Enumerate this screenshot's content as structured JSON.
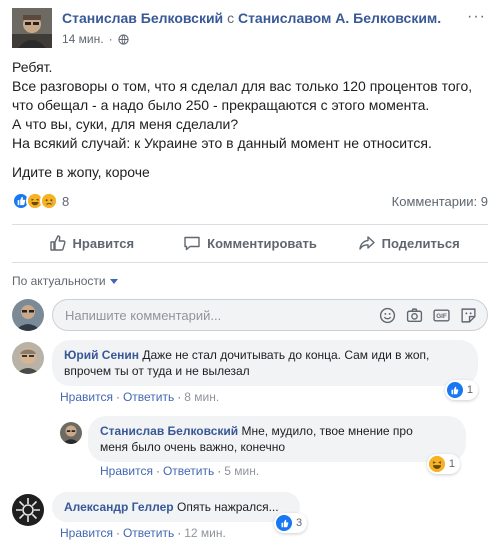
{
  "post": {
    "author": "Станислав Белковский",
    "with_prefix": "с",
    "tagged": "Станиславом А. Белковским.",
    "time": "14 мин.",
    "privacy_icon": "globe-icon",
    "options_icon": "more-icon",
    "lines": [
      "Ребят.",
      "Все разговоры о том, что я сделал для вас только 120 процентов того,",
      "что обещал - а надо было 250 - прекращаются с этого момента.",
      "А что вы, суки, для меня сделали?",
      "На всякий случай: к Украине это в данный момент не относится.",
      "Идите в жопу, короче"
    ],
    "reaction_icons": [
      "like-icon",
      "haha-icon",
      "sad-icon"
    ],
    "reaction_count": "8",
    "comments_count": "Комментарии: 9"
  },
  "actions": {
    "like": "Нравится",
    "comment": "Комментировать",
    "share": "Поделиться"
  },
  "sort_label": "По актуальности",
  "compose": {
    "placeholder": "Напишите комментарий...",
    "icons": [
      "emoji-icon",
      "camera-icon",
      "gif-icon",
      "sticker-icon"
    ]
  },
  "comments": [
    {
      "author": "Юрий Сенин",
      "text_1": "Даже не стал дочитывать до конца. Сам иди в жоп,",
      "text_2": "впрочем ты от туда и не вылезал",
      "like": "Нравится",
      "reply": "Ответить",
      "time": "8 мин.",
      "reaction_icon": "like-icon",
      "reaction_count": "1"
    },
    {
      "author": "Станислав Белковский",
      "text_1": "Мне, мудило, твое мнение про",
      "text_2": "меня было очень важно, конечно",
      "like": "Нравится",
      "reply": "Ответить",
      "time": "5 мин.",
      "reaction_icon": "haha-icon",
      "reaction_count": "1"
    },
    {
      "author": "Александр Геллер",
      "text_1": "Опять нажрался...",
      "like": "Нравится",
      "reply": "Ответить",
      "time": "12 мин.",
      "reaction_icon": "like-icon",
      "reaction_count": "3"
    }
  ],
  "colors": {
    "link": "#385898",
    "like_blue": "#1877f2",
    "haha_yellow": "#f7b125",
    "muted": "#606770"
  }
}
